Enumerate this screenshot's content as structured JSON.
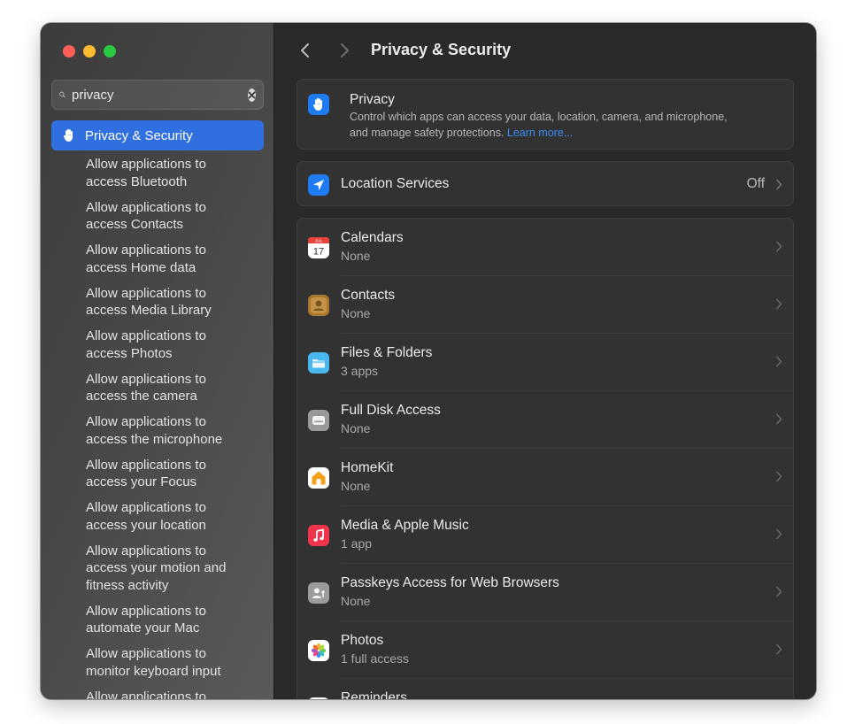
{
  "window": {
    "title": "Privacy & Security"
  },
  "sidebar": {
    "search": {
      "value": "privacy",
      "placeholder": "Search"
    },
    "selected_item": {
      "label": "Privacy & Security",
      "icon": "privacy-hand-icon"
    },
    "items": [
      {
        "line1": "Allow applications to",
        "line2": "access Bluetooth"
      },
      {
        "line1": "Allow applications to",
        "line2": "access Contacts"
      },
      {
        "line1": "Allow applications to",
        "line2": "access Home data"
      },
      {
        "line1": "Allow applications to",
        "line2": "access Media Library"
      },
      {
        "line1": "Allow applications to",
        "line2": "access Photos"
      },
      {
        "line1": "Allow applications to",
        "line2": "access the camera"
      },
      {
        "line1": "Allow applications to",
        "line2": "access the microphone"
      },
      {
        "line1": "Allow applications to",
        "line2": "access your Focus"
      },
      {
        "line1": "Allow applications to",
        "line2": "access your location"
      },
      {
        "line1": "Allow applications to",
        "line2": "access your motion and",
        "line3": "fitness activity"
      },
      {
        "line1": "Allow applications to",
        "line2": "automate your Mac"
      },
      {
        "line1": "Allow applications to",
        "line2": "monitor keyboard input"
      },
      {
        "line1": "Allow applications to"
      }
    ]
  },
  "main": {
    "intro": {
      "title": "Privacy",
      "description": "Control which apps can access your data, location, camera, and microphone, and manage safety protections.",
      "link": "Learn more..."
    },
    "location_services": {
      "label": "Location Services",
      "value": "Off"
    },
    "rows": [
      {
        "title": "Calendars",
        "subtitle": "None",
        "icon": "calendar-icon",
        "calendar_day": "17",
        "calendar_month": "JUL"
      },
      {
        "title": "Contacts",
        "subtitle": "None",
        "icon": "contacts-icon"
      },
      {
        "title": "Files & Folders",
        "subtitle": "3 apps",
        "icon": "folder-icon"
      },
      {
        "title": "Full Disk Access",
        "subtitle": "None",
        "icon": "disk-icon"
      },
      {
        "title": "HomeKit",
        "subtitle": "None",
        "icon": "home-icon"
      },
      {
        "title": "Media & Apple Music",
        "subtitle": "1 app",
        "icon": "music-icon"
      },
      {
        "title": "Passkeys Access for Web Browsers",
        "subtitle": "None",
        "icon": "passkey-icon"
      },
      {
        "title": "Photos",
        "subtitle": "1 full access",
        "icon": "photos-icon"
      },
      {
        "title": "Reminders",
        "subtitle": "",
        "icon": "reminders-icon"
      }
    ]
  },
  "colors": {
    "accent": "#2f6fe0",
    "link": "#3b8cf6",
    "window_bg": "#2a2a2a",
    "card_bg": "#323232"
  }
}
